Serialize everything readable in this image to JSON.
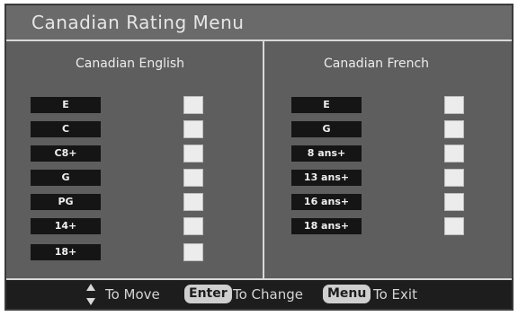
{
  "title": "Canadian Rating Menu",
  "english": {
    "heading": "Canadian English",
    "items": [
      "E",
      "C",
      "C8+",
      "G",
      "PG",
      "14+",
      "18+"
    ]
  },
  "french": {
    "heading": "Canadian French",
    "items": [
      "E",
      "G",
      "8 ans+",
      "13 ans+",
      "16 ans+",
      "18 ans+"
    ]
  },
  "footer": {
    "move_icon": "up-down-arrow-icon",
    "move_text": "To Move",
    "enter_key": "Enter",
    "change_text": "To Change",
    "menu_key": "Menu",
    "exit_text": "To Exit"
  }
}
